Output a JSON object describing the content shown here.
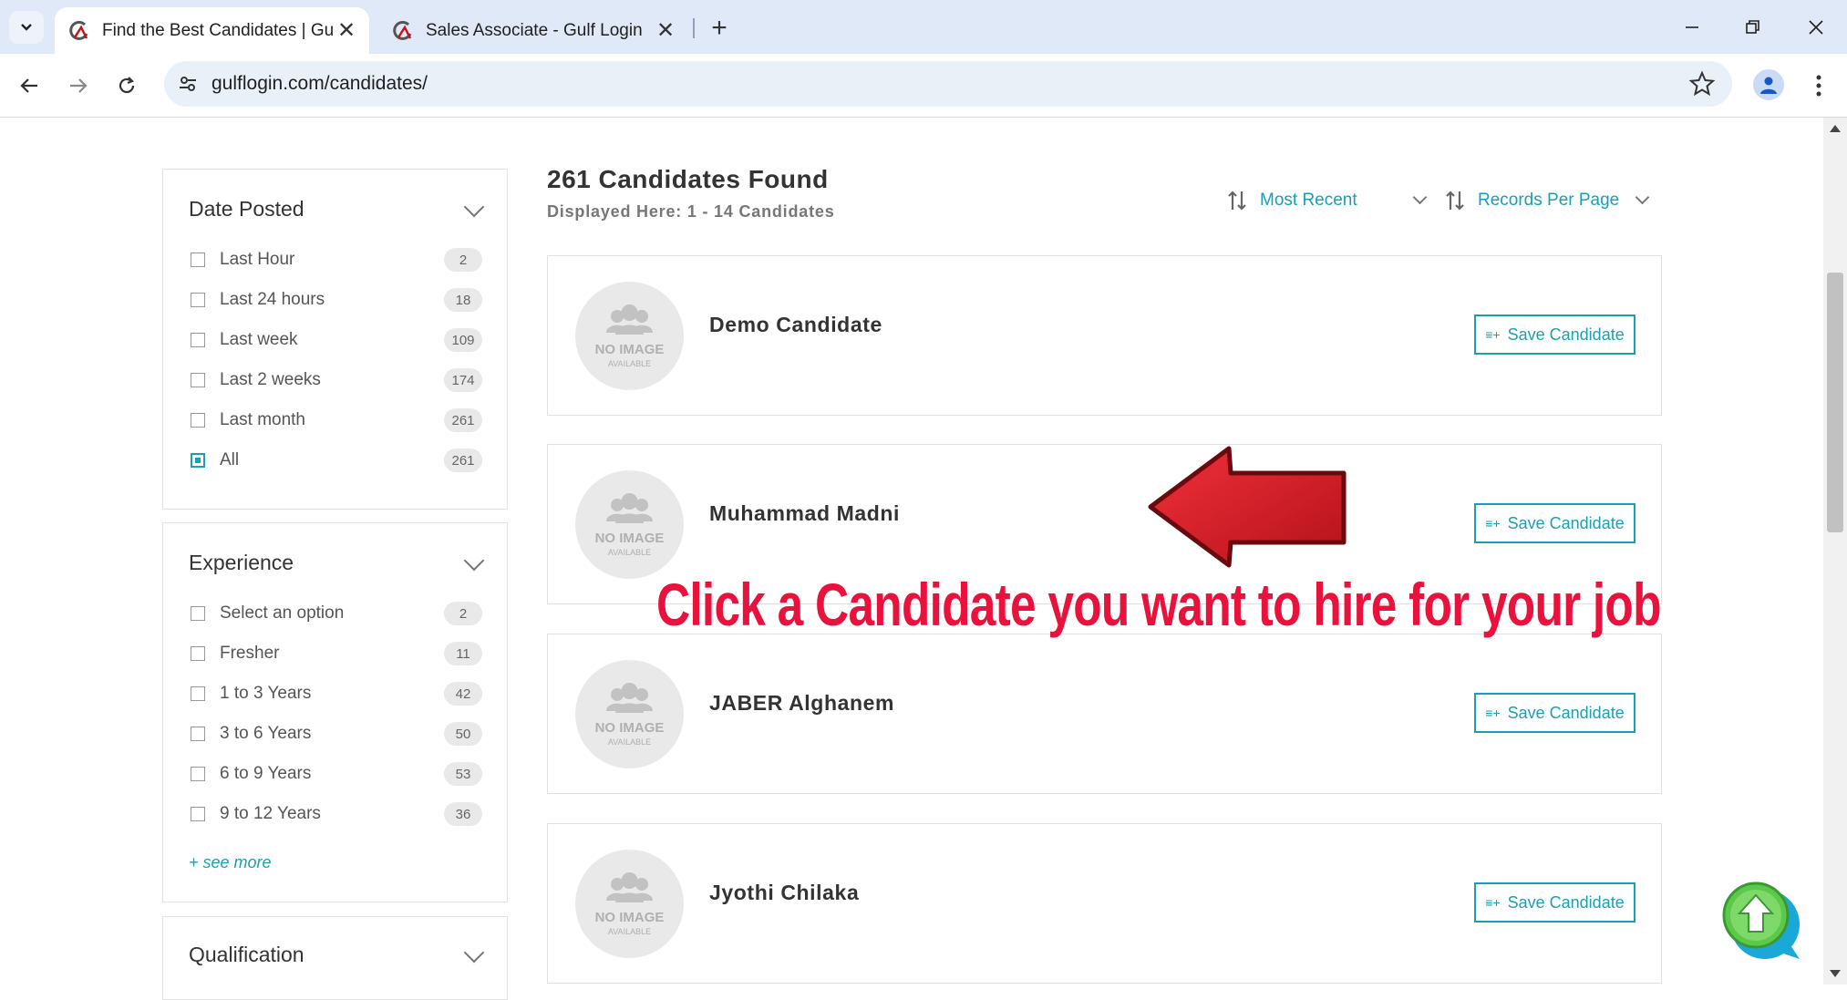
{
  "browser": {
    "tabs": [
      {
        "title": "Find the Best Candidates | Gulf",
        "active": true
      },
      {
        "title": "Sales Associate - Gulf Login",
        "active": false
      }
    ],
    "url": "gulflogin.com/candidates/"
  },
  "filters": {
    "date_posted": {
      "title": "Date Posted",
      "options": [
        {
          "label": "Last Hour",
          "count": "2",
          "checked": false
        },
        {
          "label": "Last 24 hours",
          "count": "18",
          "checked": false
        },
        {
          "label": "Last week",
          "count": "109",
          "checked": false
        },
        {
          "label": "Last 2 weeks",
          "count": "174",
          "checked": false
        },
        {
          "label": "Last month",
          "count": "261",
          "checked": false
        },
        {
          "label": "All",
          "count": "261",
          "checked": true
        }
      ]
    },
    "experience": {
      "title": "Experience",
      "options": [
        {
          "label": "Select an option",
          "count": "2",
          "checked": false
        },
        {
          "label": "Fresher",
          "count": "11",
          "checked": false
        },
        {
          "label": "1 to 3 Years",
          "count": "42",
          "checked": false
        },
        {
          "label": "3 to 6 Years",
          "count": "50",
          "checked": false
        },
        {
          "label": "6 to 9 Years",
          "count": "53",
          "checked": false
        },
        {
          "label": "9 to 12 Years",
          "count": "36",
          "checked": false
        }
      ],
      "see_more": "+ see more"
    },
    "qualification": {
      "title": "Qualification"
    }
  },
  "results": {
    "title": "261 Candidates Found",
    "subtitle": "Displayed Here: 1 - 14 Candidates",
    "sort_label": "Most Recent",
    "per_page_label": "Records Per Page"
  },
  "candidates": [
    {
      "name": "Demo Candidate",
      "save_label": "Save Candidate"
    },
    {
      "name": "Muhammad Madni",
      "save_label": "Save Candidate"
    },
    {
      "name": "JABER Alghanem",
      "save_label": "Save Candidate"
    },
    {
      "name": "Jyothi Chilaka",
      "save_label": "Save Candidate"
    }
  ],
  "no_image": {
    "line1": "NO IMAGE",
    "line2": "AVAILABLE"
  },
  "annotation": {
    "text": "Click a Candidate you want to hire for your job"
  },
  "colors": {
    "accent": "#1aa0b4",
    "annotation": "#e8123d",
    "arrow": "#c0161b"
  }
}
